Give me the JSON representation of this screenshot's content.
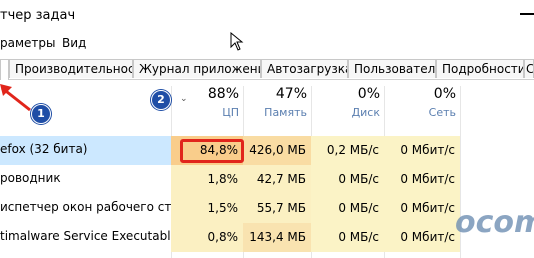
{
  "window": {
    "title": "тчер задач"
  },
  "menu": {
    "items": [
      {
        "label": "раметры"
      },
      {
        "label": "Вид"
      }
    ]
  },
  "tabs": [
    {
      "label": ""
    },
    {
      "label": "Производительность"
    },
    {
      "label": "Журнал приложений"
    },
    {
      "label": "Автозагрузка"
    },
    {
      "label": "Пользователи"
    },
    {
      "label": "Подробности"
    },
    {
      "label": "С"
    }
  ],
  "columns": {
    "cpu": {
      "percent": "88%",
      "label": "ЦП"
    },
    "memory": {
      "percent": "47%",
      "label": "Память"
    },
    "disk": {
      "percent": "0%",
      "label": "Диск"
    },
    "network": {
      "percent": "0%",
      "label": "Сеть"
    }
  },
  "processes": [
    {
      "name": "efox (32 бита)",
      "cpu": "84,8%",
      "memory": "426,0 МБ",
      "disk": "0,2 МБ/с",
      "network": "0 Мбит/с"
    },
    {
      "name": "роводник",
      "cpu": "1,8%",
      "memory": "42,7 МБ",
      "disk": "0 МБ/с",
      "network": "0 Мбит/с"
    },
    {
      "name": "испетчер окон рабочего сто...",
      "cpu": "1,5%",
      "memory": "55,7 МБ",
      "disk": "0 МБ/с",
      "network": "0 Мбит/с"
    },
    {
      "name": "timalware Service Executable",
      "cpu": "0,8%",
      "memory": "143,4 МБ",
      "disk": "0 МБ/с",
      "network": "0 Мбит/с"
    }
  ],
  "annotations": {
    "badge1": "1",
    "badge2": "2"
  },
  "watermark": {
    "text": "ocomp"
  },
  "colors": {
    "heat_high": "#f9cd8b",
    "heat_low": "#fbf3c6",
    "selected_row": "#cce8ff",
    "annotation_red": "#e1251b",
    "badge_blue": "#1f4ea6",
    "header_label": "#5b7fb0"
  }
}
